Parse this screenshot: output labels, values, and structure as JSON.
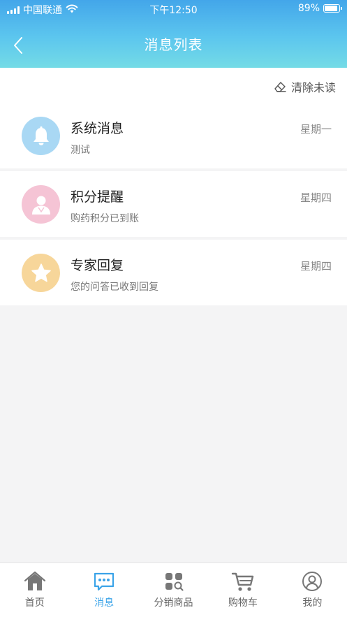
{
  "status_bar": {
    "carrier": "中国联通",
    "time": "下午12:50",
    "battery": "89%",
    "battery_level": 0.89,
    "signal_icon": "signal-icon",
    "wifi_icon": "wifi-icon"
  },
  "nav": {
    "title": "消息列表",
    "back_icon": "chevron-left-icon"
  },
  "actions": {
    "clear_unread": "清除未读",
    "clear_icon": "eraser-icon"
  },
  "messages": [
    {
      "title": "系统消息",
      "subtitle": "测试",
      "date": "星期一",
      "icon": "bell-icon",
      "color": "#a9d8f4"
    },
    {
      "title": "积分提醒",
      "subtitle": "购药积分已到账",
      "date": "星期四",
      "icon": "person-icon",
      "color": "#f5c4d5"
    },
    {
      "title": "专家回复",
      "subtitle": "您的问答已收到回复",
      "date": "星期四",
      "icon": "star-icon",
      "color": "#f7d69a"
    }
  ],
  "tabs": [
    {
      "label": "首页",
      "icon": "home-icon",
      "active": false
    },
    {
      "label": "消息",
      "icon": "chat-icon",
      "active": true
    },
    {
      "label": "分销商品",
      "icon": "apps-search-icon",
      "active": false
    },
    {
      "label": "购物车",
      "icon": "cart-icon",
      "active": false
    },
    {
      "label": "我的",
      "icon": "user-circle-icon",
      "active": false
    }
  ],
  "colors": {
    "header_gradient_top": "#43a6ea",
    "header_gradient_bottom": "#74dbe6",
    "accent": "#3aa3e8"
  }
}
